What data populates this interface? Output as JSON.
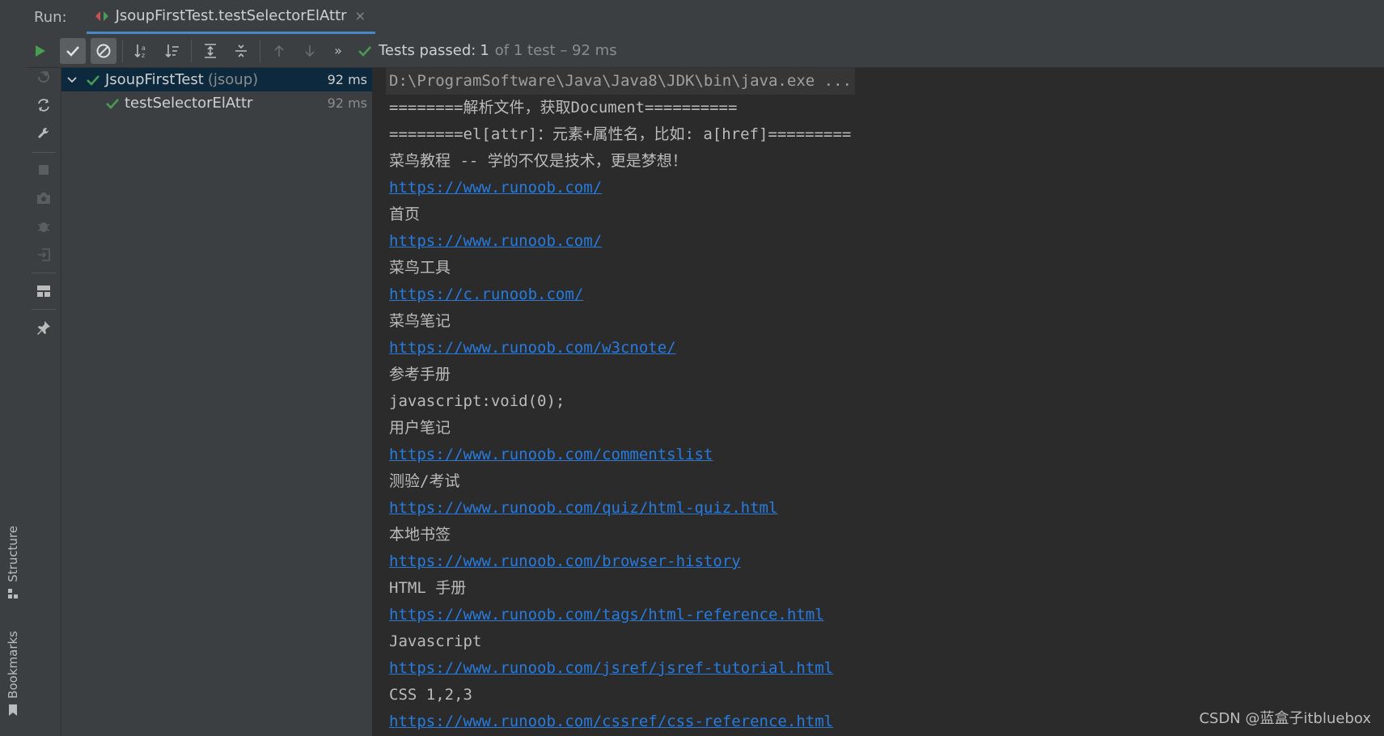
{
  "header": {
    "run_label": "Run:",
    "tab_title": "JsoupFirstTest.testSelectorElAttr",
    "close_glyph": "×"
  },
  "toolbar": {
    "status_passed": "Tests passed:",
    "status_count": "1",
    "status_rest": "of 1 test – 92 ms",
    "more_glyph": "»"
  },
  "tree": {
    "root": {
      "name": "JsoupFirstTest",
      "package": "(jsoup)",
      "duration": "92 ms"
    },
    "child": {
      "name": "testSelectorElAttr",
      "duration": "92 ms"
    }
  },
  "side_tabs": {
    "structure": "Structure",
    "bookmarks": "Bookmarks"
  },
  "console_lines": [
    "D:\\ProgramSoftware\\Java\\Java8\\JDK\\bin\\java.exe ...",
    "========解析文件，获取Document==========",
    "========el[attr]：元素+属性名，比如: a[href]=========",
    "菜鸟教程 -- 学的不仅是技术，更是梦想！",
    "https://www.runoob.com/",
    "首页",
    "https://www.runoob.com/",
    "菜鸟工具",
    "https://c.runoob.com/",
    "菜鸟笔记",
    "https://www.runoob.com/w3cnote/",
    "参考手册",
    "javascript:void(0);",
    "用户笔记",
    "https://www.runoob.com/commentslist",
    "测验/考试",
    "https://www.runoob.com/quiz/html-quiz.html",
    "本地书签",
    "https://www.runoob.com/browser-history",
    "HTML 手册",
    "https://www.runoob.com/tags/html-reference.html",
    "Javascript",
    "https://www.runoob.com/jsref/jsref-tutorial.html",
    "CSS 1,2,3",
    "https://www.runoob.com/cssref/css-reference.html"
  ],
  "watermark": "CSDN @蓝盒子itbluebox",
  "colors": {
    "accent": "#4a88c7",
    "pass_green": "#499c54",
    "link": "#287bde",
    "selection": "#0d293e"
  }
}
